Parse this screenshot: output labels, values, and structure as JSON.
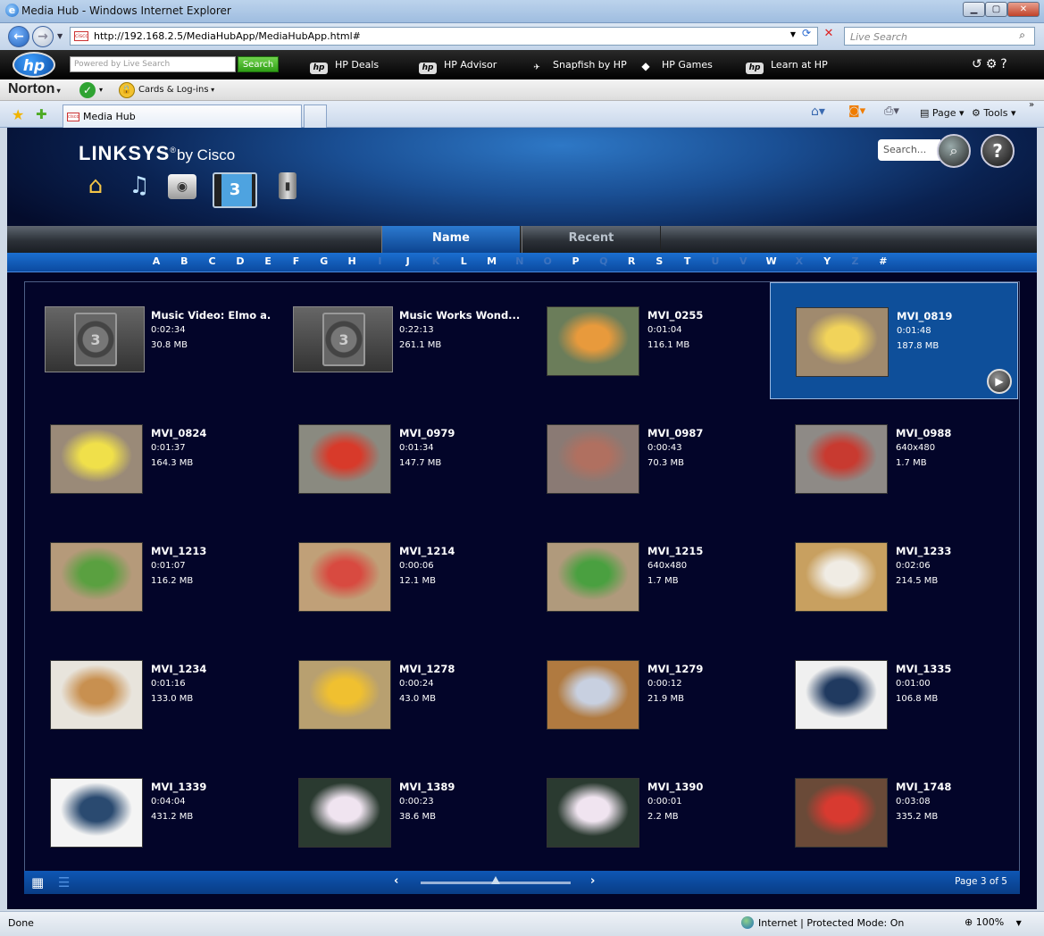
{
  "window": {
    "title": "Media Hub - Windows Internet Explorer",
    "min": "▁",
    "max": "▢",
    "close": "✕"
  },
  "address": {
    "url": "http://192.168.2.5/MediaHubApp/MediaHubApp.html#",
    "search_placeholder": "Live Search",
    "site_icon": "cisco"
  },
  "hp_toolbar": {
    "search_placeholder": "Powered by  Live Search",
    "search_button": "Search",
    "links": [
      "HP Deals",
      "HP Advisor",
      "Snapfish by HP",
      "HP Games",
      "Learn at HP"
    ]
  },
  "norton": {
    "logo": "Norton",
    "cards": "Cards & Log-ins"
  },
  "browser_tab": {
    "label": "Media Hub"
  },
  "commands": {
    "page": "Page",
    "tools": "Tools"
  },
  "app": {
    "brand_main": "LINKSYS",
    "brand_reg": "®",
    "brand_by": "by Cisco",
    "search_placeholder": "Search...",
    "view_tabs": [
      {
        "label": "Name",
        "active": true
      },
      {
        "label": "Recent",
        "active": false
      }
    ],
    "letters": [
      {
        "l": "A",
        "on": true
      },
      {
        "l": "B",
        "on": true
      },
      {
        "l": "C",
        "on": true
      },
      {
        "l": "D",
        "on": true
      },
      {
        "l": "E",
        "on": true
      },
      {
        "l": "F",
        "on": true
      },
      {
        "l": "G",
        "on": true
      },
      {
        "l": "H",
        "on": true
      },
      {
        "l": "I",
        "on": false
      },
      {
        "l": "J",
        "on": true
      },
      {
        "l": "K",
        "on": false
      },
      {
        "l": "L",
        "on": true
      },
      {
        "l": "M",
        "on": true
      },
      {
        "l": "N",
        "on": false
      },
      {
        "l": "O",
        "on": false
      },
      {
        "l": "P",
        "on": true
      },
      {
        "l": "Q",
        "on": false
      },
      {
        "l": "R",
        "on": true
      },
      {
        "l": "S",
        "on": true
      },
      {
        "l": "T",
        "on": true
      },
      {
        "l": "U",
        "on": false
      },
      {
        "l": "V",
        "on": false
      },
      {
        "l": "W",
        "on": true
      },
      {
        "l": "X",
        "on": false
      },
      {
        "l": "Y",
        "on": true
      },
      {
        "l": "Z",
        "on": false
      },
      {
        "l": "#",
        "on": true
      }
    ],
    "videos": [
      {
        "title": "Music Video: Elmo a...",
        "duration": "0:02:34",
        "size": "30.8 MB",
        "thumb": "placeholder"
      },
      {
        "title": "Music Works Wond...",
        "duration": "0:22:13",
        "size": "261.1 MB",
        "thumb": "placeholder"
      },
      {
        "title": "MVI_0255",
        "duration": "0:01:04",
        "size": "116.1 MB",
        "thumb": "baby-stroller",
        "colors": [
          "#6b7d5a",
          "#e89a3c"
        ]
      },
      {
        "title": "MVI_0819",
        "duration": "0:01:48",
        "size": "187.8 MB",
        "thumb": "baby-face",
        "colors": [
          "#a08a6e",
          "#f1d35a"
        ],
        "selected": true
      },
      {
        "title": "MVI_0824",
        "duration": "0:01:37",
        "size": "164.3 MB",
        "thumb": "baby-bib",
        "colors": [
          "#9a8a78",
          "#f0e04a"
        ]
      },
      {
        "title": "MVI_0979",
        "duration": "0:01:34",
        "size": "147.7 MB",
        "thumb": "red-car",
        "colors": [
          "#8a8a80",
          "#d83a2a"
        ]
      },
      {
        "title": "MVI_0987",
        "duration": "0:00:43",
        "size": "70.3 MB",
        "thumb": "street",
        "colors": [
          "#8a7a74",
          "#b07060"
        ]
      },
      {
        "title": "MVI_0988",
        "duration": "640x480",
        "size": "1.7 MB",
        "thumb": "street-car",
        "colors": [
          "#8e8a86",
          "#c83a30"
        ]
      },
      {
        "title": "MVI_1213",
        "duration": "0:01:07",
        "size": "116.2 MB",
        "thumb": "baby-toys",
        "colors": [
          "#b59a7a",
          "#5aa040"
        ]
      },
      {
        "title": "MVI_1214",
        "duration": "0:00:06",
        "size": "12.1 MB",
        "thumb": "baby-smile",
        "colors": [
          "#c0a078",
          "#d84a40"
        ]
      },
      {
        "title": "MVI_1215",
        "duration": "640x480",
        "size": "1.7 MB",
        "thumb": "baby-toys",
        "colors": [
          "#b09a7c",
          "#4aa040"
        ]
      },
      {
        "title": "MVI_1233",
        "duration": "0:02:06",
        "size": "214.5 MB",
        "thumb": "doorway",
        "colors": [
          "#c8a060",
          "#f0ece4"
        ]
      },
      {
        "title": "MVI_1234",
        "duration": "0:01:16",
        "size": "133.0 MB",
        "thumb": "crawling",
        "colors": [
          "#e8e4dc",
          "#c89050"
        ]
      },
      {
        "title": "MVI_1278",
        "duration": "0:00:24",
        "size": "43.0 MB",
        "thumb": "walker",
        "colors": [
          "#b8a070",
          "#f0c030"
        ]
      },
      {
        "title": "MVI_1279",
        "duration": "0:00:12",
        "size": "21.9 MB",
        "thumb": "floor",
        "colors": [
          "#b07a40",
          "#c8d0e0"
        ]
      },
      {
        "title": "MVI_1335",
        "duration": "0:01:00",
        "size": "106.8 MB",
        "thumb": "crowd",
        "colors": [
          "#f0f0f0",
          "#203a60"
        ]
      },
      {
        "title": "MVI_1339",
        "duration": "0:04:04",
        "size": "431.2 MB",
        "thumb": "crowd",
        "colors": [
          "#f4f4f4",
          "#2a4a70"
        ]
      },
      {
        "title": "MVI_1389",
        "duration": "0:00:23",
        "size": "38.6 MB",
        "thumb": "swing",
        "colors": [
          "#2a3a30",
          "#f0e4f0"
        ]
      },
      {
        "title": "MVI_1390",
        "duration": "0:00:01",
        "size": "2.2 MB",
        "thumb": "swing",
        "colors": [
          "#2a3a30",
          "#f0e4f0"
        ]
      },
      {
        "title": "MVI_1748",
        "duration": "0:03:08",
        "size": "335.2 MB",
        "thumb": "room",
        "colors": [
          "#6a4a38",
          "#d83a30"
        ]
      }
    ],
    "pager": {
      "label": "Page 3 of 5",
      "current": 3,
      "total": 5
    }
  },
  "status": {
    "left": "Done",
    "zone": "Internet | Protected Mode: On",
    "zoom": "100%"
  }
}
